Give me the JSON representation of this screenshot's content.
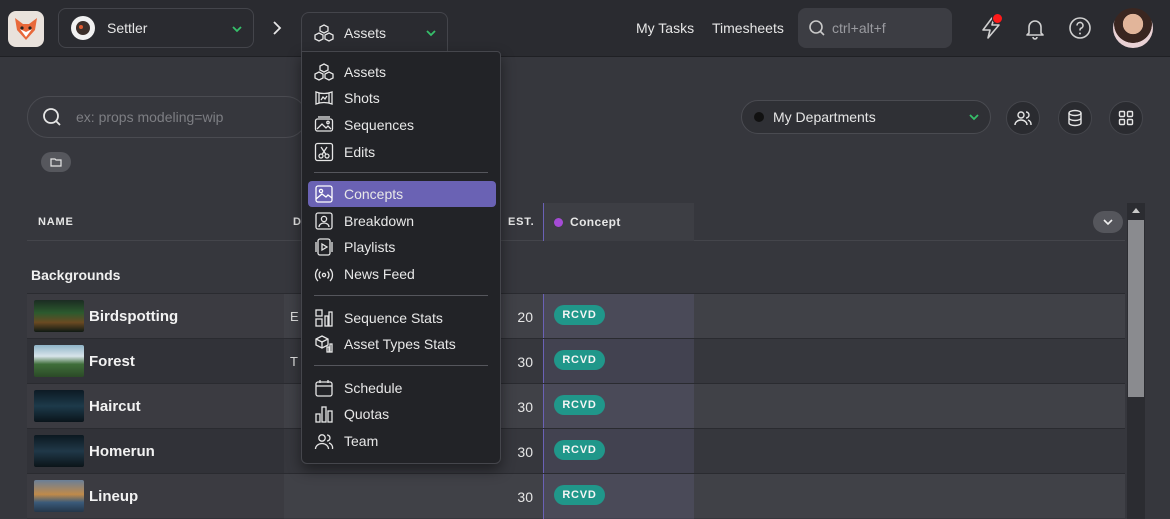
{
  "topbar": {
    "production": "Settler",
    "section": "Assets",
    "links": {
      "my_tasks": "My Tasks",
      "timesheets": "Timesheets"
    },
    "search_placeholder": "ctrl+alt+f",
    "icons": [
      "lightning-icon",
      "bell-icon",
      "help-icon"
    ],
    "notification_dot_color": "#ff1a1a"
  },
  "filters": {
    "search_placeholder": "ex: props modeling=wip",
    "department": "My Departments"
  },
  "table": {
    "headers": {
      "name": "NAME",
      "description": "D",
      "estimation": "EST.",
      "concept": "Concept"
    },
    "concept_color": "#a54bd6",
    "group": "Backgrounds",
    "rows": [
      {
        "name": "Birdspotting",
        "description": "E",
        "est": "20",
        "status": "RCVD"
      },
      {
        "name": "Forest",
        "description": "T",
        "est": "30",
        "status": "RCVD"
      },
      {
        "name": "Haircut",
        "description": "",
        "est": "30",
        "status": "RCVD"
      },
      {
        "name": "Homerun",
        "description": "",
        "est": "30",
        "status": "RCVD"
      },
      {
        "name": "Lineup",
        "description": "",
        "est": "30",
        "status": "RCVD"
      }
    ],
    "status_color": "#20978a"
  },
  "menu": {
    "groups": [
      [
        "Assets",
        "Shots",
        "Sequences",
        "Edits"
      ],
      [
        "Concepts",
        "Breakdown",
        "Playlists",
        "News Feed"
      ],
      [
        "Sequence Stats",
        "Asset Types Stats"
      ],
      [
        "Schedule",
        "Quotas",
        "Team"
      ]
    ],
    "active": "Concepts",
    "active_color": "#6a62b4"
  }
}
